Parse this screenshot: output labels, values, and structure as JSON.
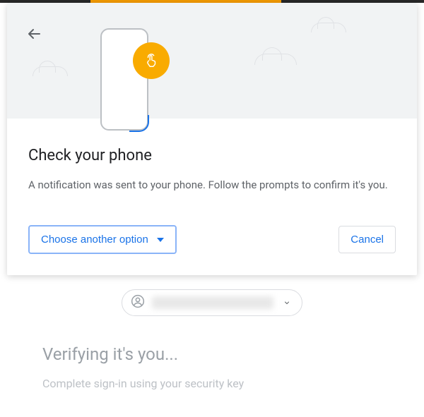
{
  "modal": {
    "heading": "Check your phone",
    "subtext": "A notification was sent to your phone. Follow the prompts to confirm it's you.",
    "choose_label": "Choose another option",
    "cancel_label": "Cancel"
  },
  "backdrop": {
    "heading": "Verifying it's you...",
    "subtext": "Complete sign-in using your security key"
  }
}
